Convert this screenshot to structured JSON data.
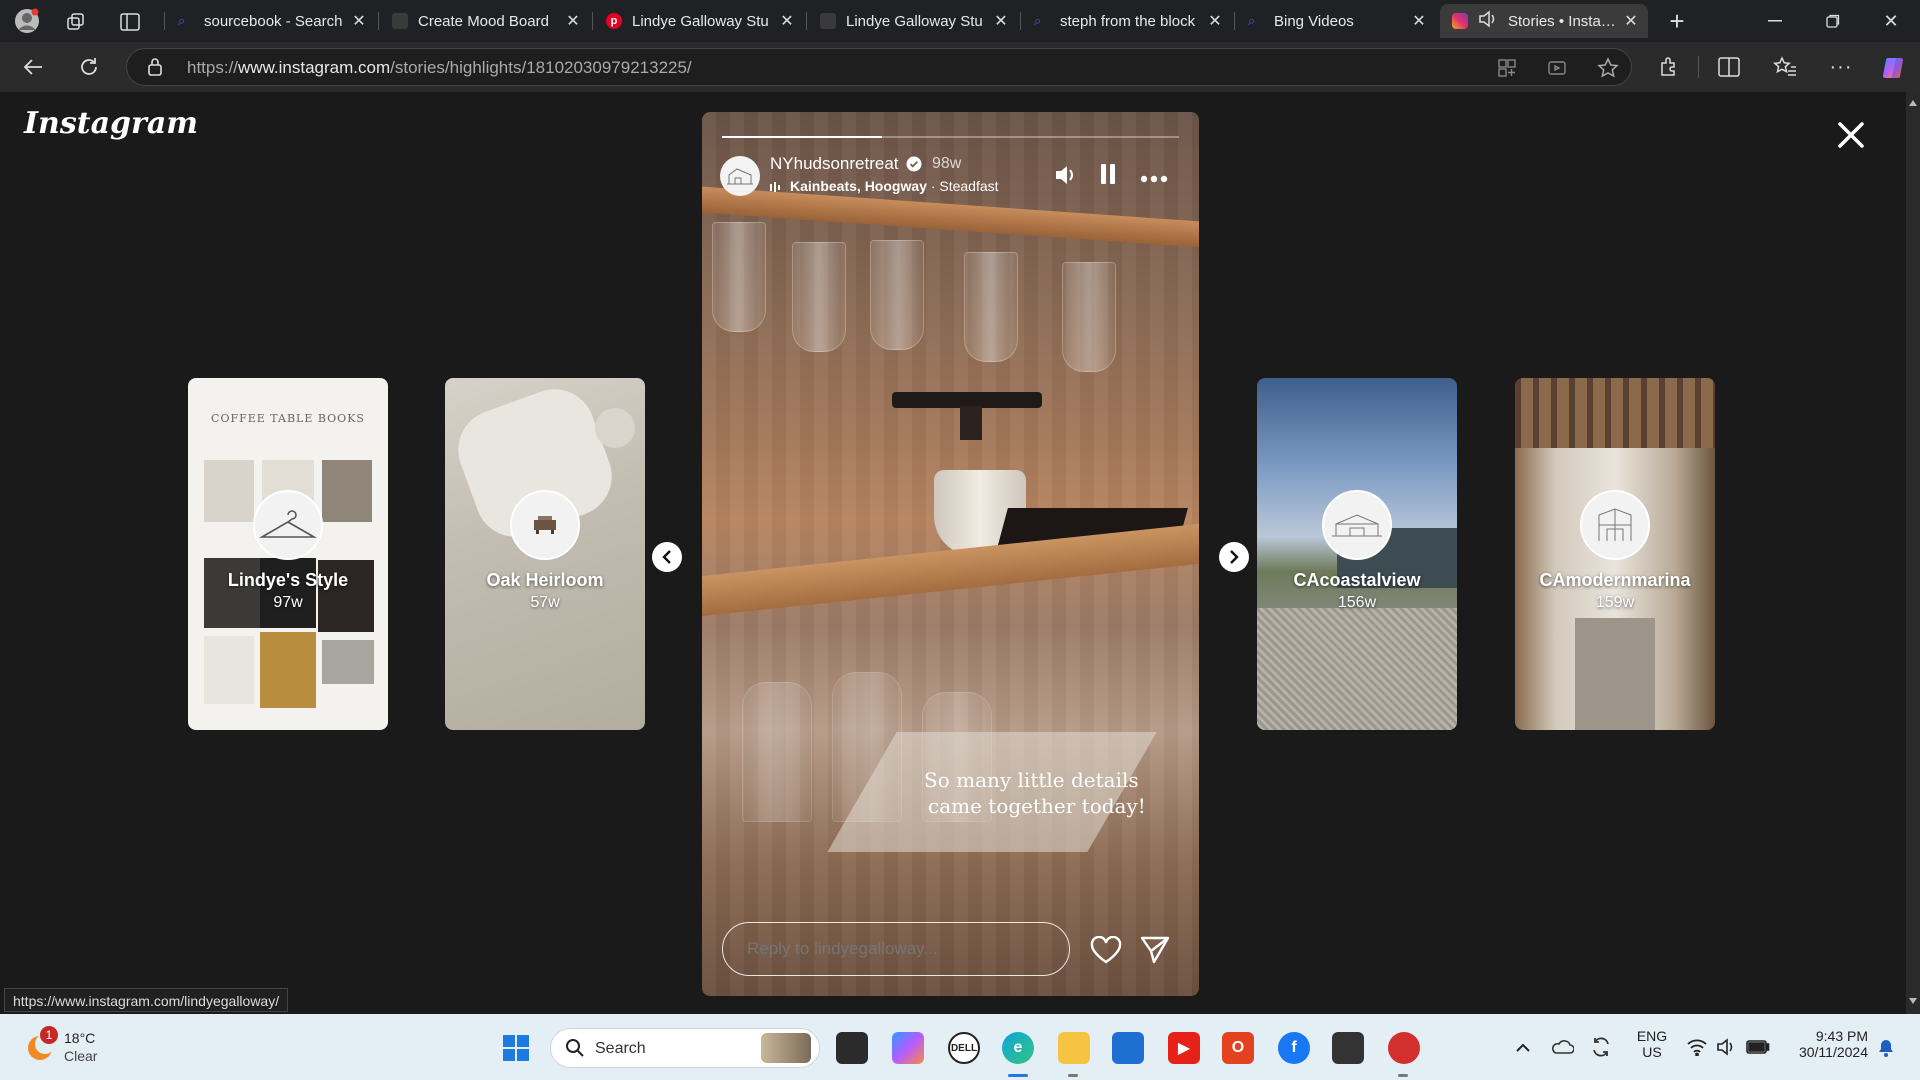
{
  "tabs": [
    {
      "title": "sourcebook - Search",
      "favicon_color": "#3b5bdb",
      "icon": "search-icon"
    },
    {
      "title": "Create Mood Board",
      "favicon_color": "#444444",
      "icon": "page-icon"
    },
    {
      "title": "Lindye Galloway Stu",
      "favicon_color": "#e60023",
      "icon": "pinterest-icon"
    },
    {
      "title": "Lindye Galloway Stu",
      "favicon_color": "#666666",
      "icon": "page-icon"
    },
    {
      "title": "steph from the block",
      "favicon_color": "#3b5bdb",
      "icon": "search-icon"
    },
    {
      "title": "Bing Videos",
      "favicon_color": "#3b5bdb",
      "icon": "search-icon"
    },
    {
      "title": "Stories • Instagram",
      "favicon_color": "#e1306c",
      "icon": "instagram-icon",
      "active": true
    }
  ],
  "address": {
    "prefix": "https://",
    "domain": "www.instagram.com",
    "path": "/stories/highlights/18102030979213225/"
  },
  "instagram": {
    "logo_text": "Instagram"
  },
  "previews_left": [
    {
      "name": "Lindye's Style",
      "age": "97w",
      "board_title": "COFFEE TABLE BOOKS"
    },
    {
      "name": "Oak Heirloom",
      "age": "57w"
    }
  ],
  "previews_right": [
    {
      "name": "CAcoastalview",
      "age": "156w"
    },
    {
      "name": "CAmodernmarina",
      "age": "159w"
    }
  ],
  "story": {
    "username": "NYhudsonretreat",
    "age": "98w",
    "music_artists": "Kainbeats, Hoogway",
    "music_track": "Steadfast",
    "caption_line1": "So many little details",
    "caption_line2": "came together today!",
    "reply_placeholder": "Reply to lindyegalloway...",
    "progress": 0.35
  },
  "status_url": "https://www.instagram.com/lindyegalloway/",
  "taskbar": {
    "weather_temp": "18°C",
    "weather_desc": "Clear",
    "weather_badge": "1",
    "search_label": "Search",
    "lang_top": "ENG",
    "lang_bottom": "US",
    "time": "9:43 PM",
    "date": "30/11/2024"
  }
}
